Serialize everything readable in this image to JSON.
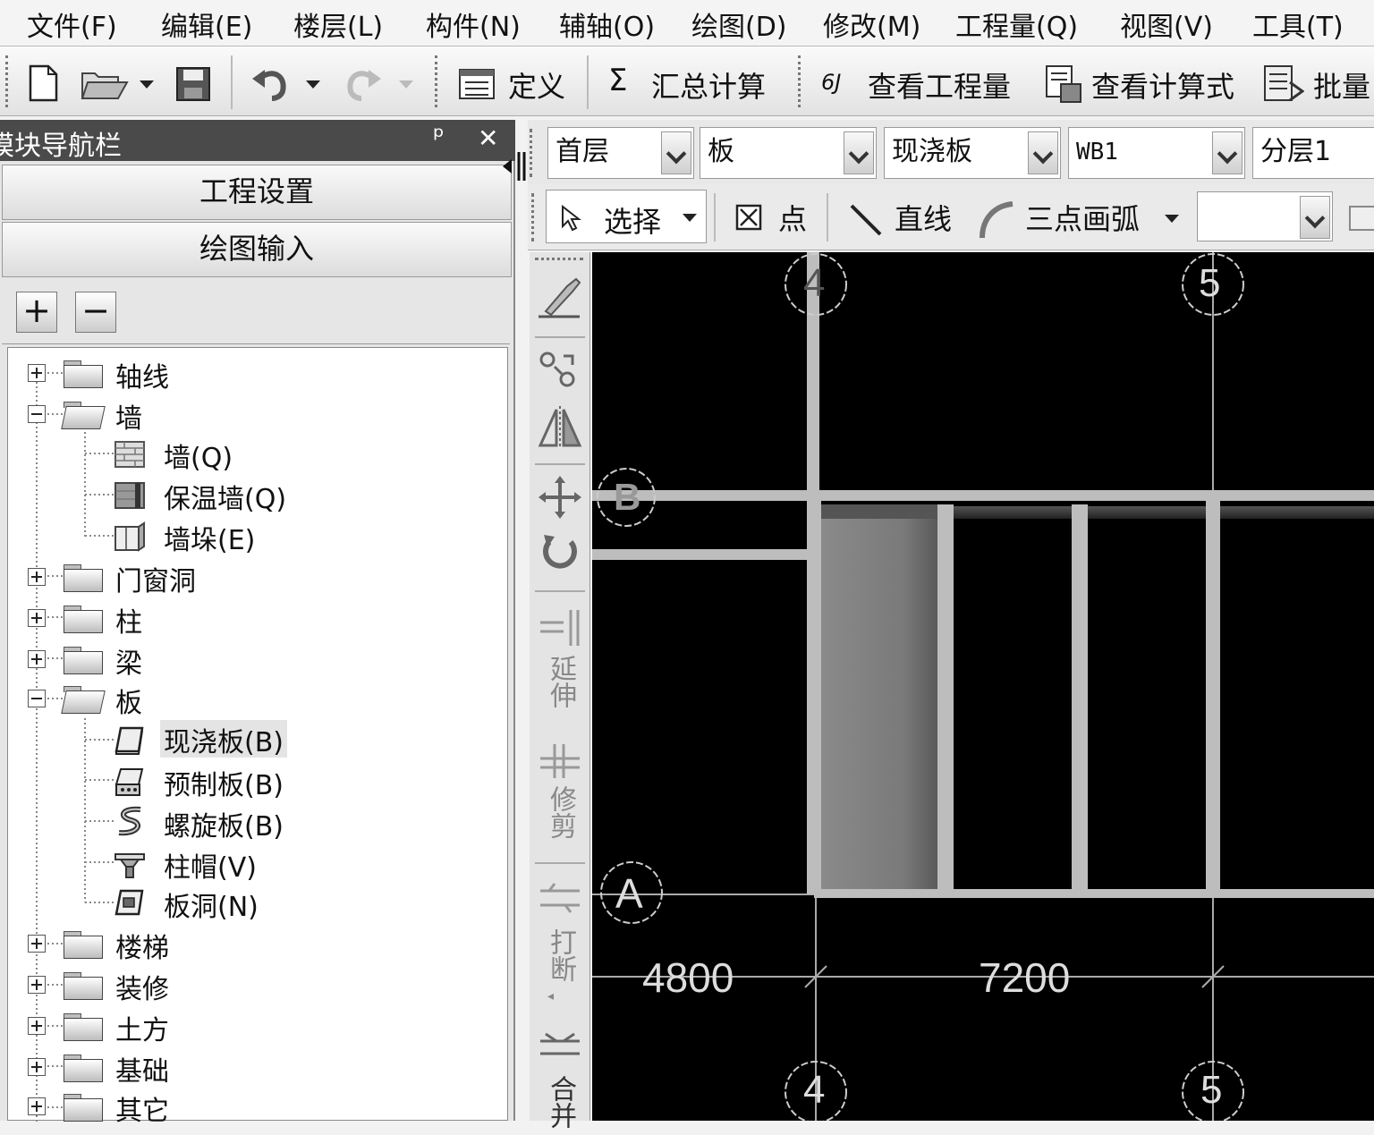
{
  "menu": [
    "文件(F)",
    "编辑(E)",
    "楼层(L)",
    "构件(N)",
    "辅轴(O)",
    "绘图(D)",
    "修改(M)",
    "工程量(Q)",
    "视图(V)",
    "工具(T)"
  ],
  "toolbar": {
    "define": "定义",
    "sum_calc": "汇总计算",
    "view_quantity": "查看工程量",
    "view_formula": "查看计算式",
    "batch": "批量"
  },
  "nav": {
    "title": "模块导航栏",
    "pin": "ᵖ",
    "close": "✕",
    "project_settings": "工程设置",
    "drawing_input": "绘图输入"
  },
  "tree": [
    {
      "label": "轴线",
      "expanded": false
    },
    {
      "label": "墙",
      "expanded": true
    },
    {
      "label": "墙(Q)",
      "child": true
    },
    {
      "label": "保温墙(Q)",
      "child": true
    },
    {
      "label": "墙垛(E)",
      "child": true
    },
    {
      "label": "门窗洞",
      "expanded": false
    },
    {
      "label": "柱",
      "expanded": false
    },
    {
      "label": "梁",
      "expanded": false
    },
    {
      "label": "板",
      "expanded": true
    },
    {
      "label": "现浇板(B)",
      "child": true,
      "selected": true
    },
    {
      "label": "预制板(B)",
      "child": true
    },
    {
      "label": "螺旋板(B)",
      "child": true
    },
    {
      "label": "柱帽(V)",
      "child": true
    },
    {
      "label": "板洞(N)",
      "child": true
    },
    {
      "label": "楼梯",
      "expanded": false
    },
    {
      "label": "装修",
      "expanded": false
    },
    {
      "label": "土方",
      "expanded": false
    },
    {
      "label": "基础",
      "expanded": false
    },
    {
      "label": "其它",
      "expanded": false
    }
  ],
  "combos": {
    "floor": "首层",
    "category": "板",
    "type": "现浇板",
    "component": "WB1",
    "layer": "分层1"
  },
  "draw_tools": {
    "select": "选择",
    "point": "点",
    "line": "直线",
    "arc": "三点画弧"
  },
  "vertical_tools": {
    "extend": "延伸",
    "trim": "修剪",
    "break": "打断",
    "merge": "合并"
  },
  "canvas": {
    "axis_top_4": "4",
    "axis_top_5": "5",
    "axis_b": "B",
    "axis_a": "A",
    "axis_bottom_4": "4",
    "axis_bottom_5": "5",
    "dim_left": "4800",
    "dim_right": "7200"
  }
}
